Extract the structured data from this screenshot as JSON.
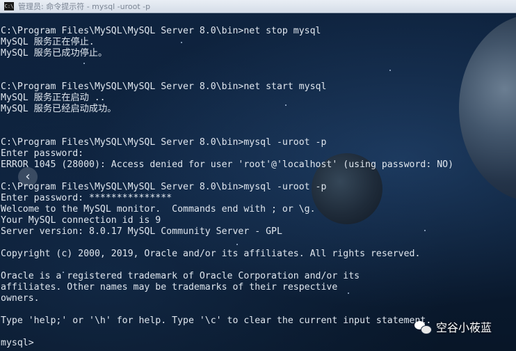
{
  "window": {
    "title": "管理员: 命令提示符 - mysql -uroot -p",
    "icon_text": "C:\\"
  },
  "console": {
    "lines": [
      "C:\\Program Files\\MySQL\\MySQL Server 8.0\\bin>net stop mysql",
      "MySQL 服务正在停止.",
      "MySQL 服务已成功停止。",
      "",
      "",
      "C:\\Program Files\\MySQL\\MySQL Server 8.0\\bin>net start mysql",
      "MySQL 服务正在启动 ..",
      "MySQL 服务已经启动成功。",
      "",
      "",
      "C:\\Program Files\\MySQL\\MySQL Server 8.0\\bin>mysql -uroot -p",
      "Enter password:",
      "ERROR 1045 (28000): Access denied for user 'root'@'localhost' (using password: NO)",
      "",
      "C:\\Program Files\\MySQL\\MySQL Server 8.0\\bin>mysql -uroot -p",
      "Enter password: ***************",
      "Welcome to the MySQL monitor.  Commands end with ; or \\g.",
      "Your MySQL connection id is 9",
      "Server version: 8.0.17 MySQL Community Server - GPL",
      "",
      "Copyright (c) 2000, 2019, Oracle and/or its affiliates. All rights reserved.",
      "",
      "Oracle is a registered trademark of Oracle Corporation and/or its",
      "affiliates. Other names may be trademarks of their respective",
      "owners.",
      "",
      "Type 'help;' or '\\h' for help. Type '\\c' to clear the current input statement.",
      "",
      "mysql>"
    ]
  },
  "nav": {
    "prev_arrow": "‹"
  },
  "watermark": {
    "text": "空谷小莜蓝",
    "icon": "wechat-icon"
  },
  "colors": {
    "text": "#dfe6ee",
    "background": "#0b1a2e"
  }
}
